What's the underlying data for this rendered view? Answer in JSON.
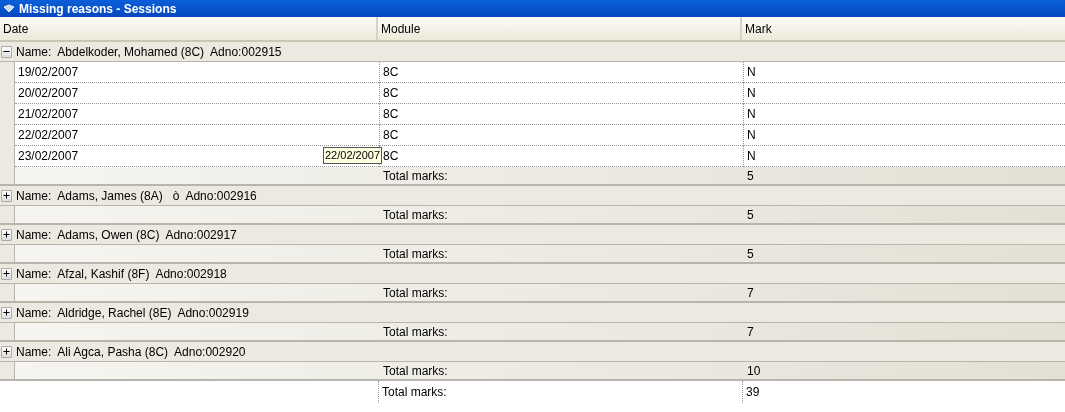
{
  "window": {
    "title": "Missing reasons - Sessions"
  },
  "columns": [
    "Date",
    "Module",
    "Mark"
  ],
  "groups": [
    {
      "name": "Name:  Abdelkoder, Mohamed (8C)  Adno:002915",
      "expanded": true,
      "rows": [
        {
          "date": "19/02/2007",
          "module": "8C",
          "mark": "N"
        },
        {
          "date": "20/02/2007",
          "module": "8C",
          "mark": "N"
        },
        {
          "date": "21/02/2007",
          "module": "8C",
          "mark": "N"
        },
        {
          "date": "22/02/2007",
          "module": "8C",
          "mark": "N"
        },
        {
          "date": "23/02/2007",
          "module": "8C",
          "mark": "N"
        }
      ],
      "total_label": "Total marks:",
      "total": "5"
    },
    {
      "name": "Name:  Adams, James (8A)   ò  Adno:002916",
      "expanded": false,
      "total_label": "Total marks:",
      "total": "5"
    },
    {
      "name": "Name:  Adams, Owen (8C)  Adno:002917",
      "expanded": false,
      "total_label": "Total marks:",
      "total": "5"
    },
    {
      "name": "Name:  Afzal, Kashif (8F)  Adno:002918",
      "expanded": false,
      "total_label": "Total marks:",
      "total": "7"
    },
    {
      "name": "Name:  Aldridge, Rachel (8E)  Adno:002919",
      "expanded": false,
      "total_label": "Total marks:",
      "total": "7"
    },
    {
      "name": "Name:  Ali Agca, Pasha (8C)  Adno:002920",
      "expanded": false,
      "total_label": "Total marks:",
      "total": "10"
    }
  ],
  "grand_total": {
    "label": "Total marks:",
    "value": "39"
  },
  "tooltip": "22/02/2007"
}
